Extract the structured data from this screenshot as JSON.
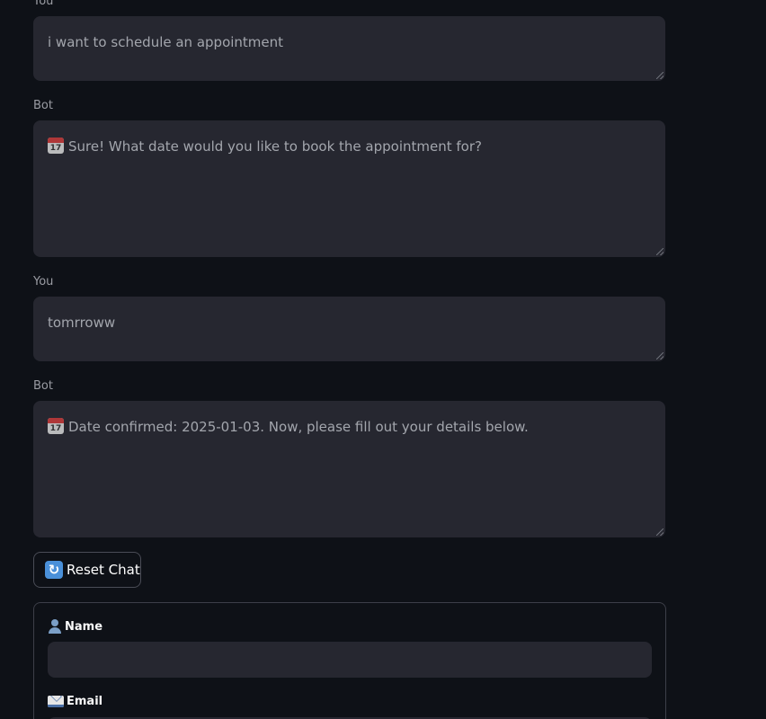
{
  "chat": {
    "messages": [
      {
        "speaker": "You",
        "text": "i want to schedule an appointment"
      },
      {
        "speaker": "Bot",
        "icon": "calendar-icon",
        "text": "Sure! What date would you like to book the appointment for?"
      },
      {
        "speaker": "You",
        "text": "tomrroww"
      },
      {
        "speaker": "Bot",
        "icon": "calendar-icon",
        "text": "Date confirmed: 2025-01-03. Now, please fill out your details below."
      }
    ],
    "calendar_icon_day": "17"
  },
  "reset_button": {
    "icon": "refresh-icon",
    "label": "Reset Chat"
  },
  "form": {
    "name_label": "Name",
    "name_value": "",
    "email_label": "Email"
  },
  "colors": {
    "background": "#0e1117",
    "input_background": "#262730",
    "text_muted": "#a3a6ad",
    "label": "#9a9ca3"
  }
}
